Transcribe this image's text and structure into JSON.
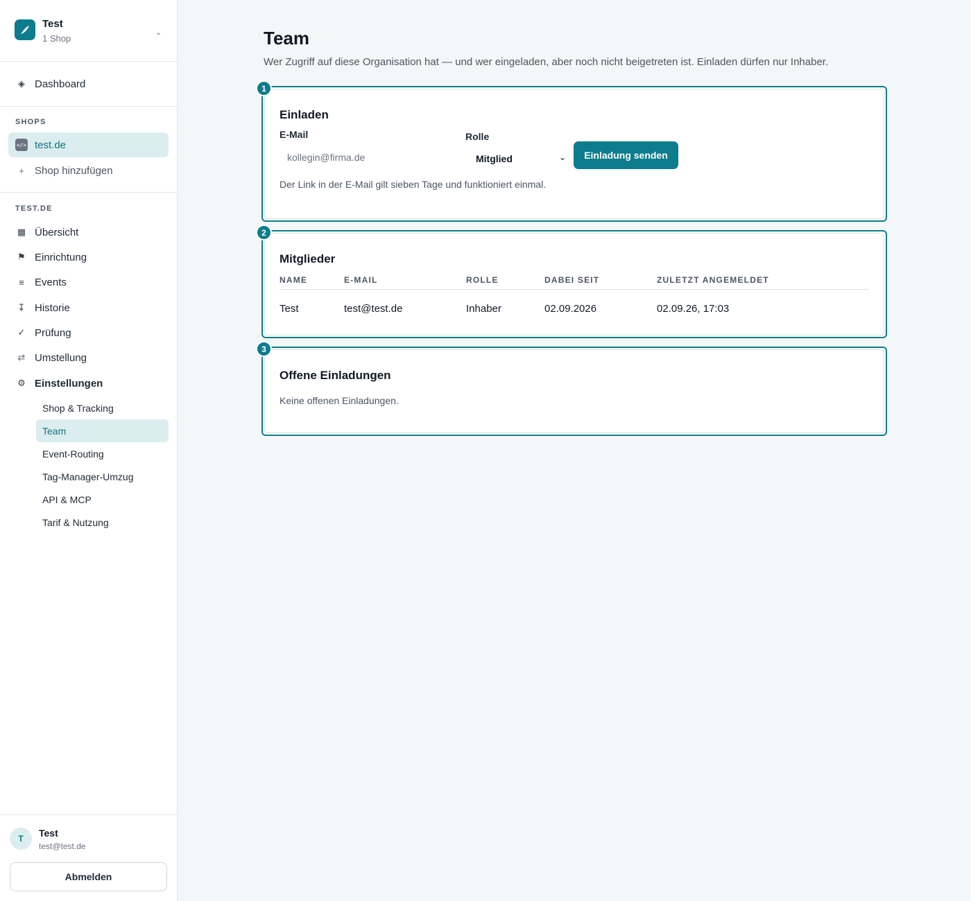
{
  "org": {
    "name": "Test",
    "subtitle": "1 Shop"
  },
  "nav": {
    "dashboard": "Dashboard",
    "shops_section": "SHOPS",
    "shop_name": "test.de",
    "shop_icon_text": "</>",
    "add_shop": "Shop hinzufügen",
    "shop_section": "TEST.DE",
    "items": [
      {
        "label": "Übersicht",
        "icon": "grid-icon"
      },
      {
        "label": "Einrichtung",
        "icon": "flag-icon"
      },
      {
        "label": "Events",
        "icon": "list-icon"
      },
      {
        "label": "Historie",
        "icon": "history-icon"
      },
      {
        "label": "Prüfung",
        "icon": "check-icon"
      },
      {
        "label": "Umstellung",
        "icon": "swap-icon"
      },
      {
        "label": "Einstellungen",
        "icon": "gear-icon"
      }
    ],
    "settings_sub": [
      "Shop & Tracking",
      "Team",
      "Event-Routing",
      "Tag-Manager-Umzug",
      "API & MCP",
      "Tarif & Nutzung"
    ]
  },
  "user": {
    "initial": "T",
    "name": "Test",
    "email": "test@test.de",
    "logout": "Abmelden"
  },
  "page": {
    "title": "Team",
    "description": "Wer Zugriff auf diese Organisation hat — und wer eingeladen, aber noch nicht beigetreten ist. Einladen dürfen nur Inhaber."
  },
  "invite": {
    "step": "1",
    "title": "Einladen",
    "email_label": "E-Mail",
    "email_placeholder": "kollegin@firma.de",
    "email_value": "",
    "role_label": "Rolle",
    "role_value": "Mitglied",
    "send_label": "Einladung senden",
    "hint": "Der Link in der E-Mail gilt sieben Tage und funktioniert einmal."
  },
  "members": {
    "step": "2",
    "title": "Mitglieder",
    "columns": [
      "NAME",
      "E-MAIL",
      "ROLLE",
      "DABEI SEIT",
      "ZULETZT ANGEMELDET"
    ],
    "rows": [
      [
        "Test",
        "test@test.de",
        "Inhaber",
        "02.09.2026",
        "02.09.26, 17:03"
      ]
    ]
  },
  "pending": {
    "step": "3",
    "title": "Offene Einladungen",
    "empty": "Keine offenen Einladungen."
  },
  "colors": {
    "accent": "#0d7c8c",
    "active_bg": "#dcedf0",
    "background": "#f3f7f7"
  }
}
